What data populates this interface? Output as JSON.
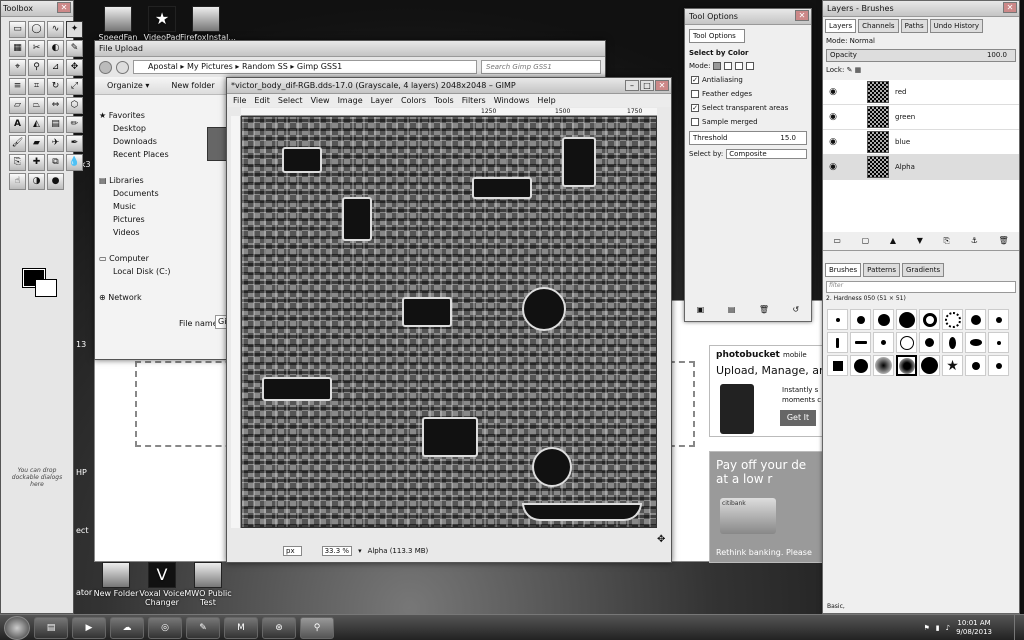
{
  "toolbox": {
    "title": "Toolbox",
    "hint": "You can drop dockable dialogs here"
  },
  "desktop": {
    "icons": [
      {
        "label": "SpeedFan"
      },
      {
        "label": "VideoPad"
      },
      {
        "label": "FirefoxInstal..."
      },
      {
        "label": "New Folder"
      },
      {
        "label": "Voxal Voice Changer"
      },
      {
        "label": "MWO Public Test"
      }
    ],
    "edge_fragments": [
      "HP",
      "ect",
      "ator",
      "ak3",
      "13"
    ]
  },
  "file_upload": {
    "title": "File Upload",
    "breadcrumb": [
      "Apostal",
      "My Pictures",
      "Random SS",
      "Gimp GSS1"
    ],
    "search_placeholder": "Search Gimp GSS1",
    "organize": "Organize ▾",
    "new_folder": "New folder",
    "nav": [
      "Favorites",
      "Desktop",
      "Downloads",
      "Recent Places",
      "",
      "Libraries",
      "Documents",
      "Music",
      "Pictures",
      "Videos",
      "",
      "Computer",
      "Local Disk (C:)",
      "",
      "Network"
    ],
    "file_name_label": "File name:",
    "file_name_value": "Gim"
  },
  "gimp": {
    "title": "*victor_body_dif-RGB.dds-17.0 (Grayscale, 4 layers) 2048x2048 – GIMP",
    "menu": [
      "File",
      "Edit",
      "Select",
      "View",
      "Image",
      "Layer",
      "Colors",
      "Tools",
      "Filters",
      "Windows",
      "Help"
    ],
    "ruler_ticks": [
      "1250",
      "1500",
      "1750"
    ],
    "status": {
      "unit": "px",
      "zoom": "33.3 %",
      "info": "Alpha (113.3 MB)"
    }
  },
  "tool_options": {
    "title": "Tool Options",
    "tab": "Tool Options",
    "section": "Select by Color",
    "mode_label": "Mode:",
    "options": [
      {
        "label": "Antialiasing",
        "checked": true
      },
      {
        "label": "Feather edges",
        "checked": false
      },
      {
        "label": "Select transparent areas",
        "checked": true
      },
      {
        "label": "Sample merged",
        "checked": false
      }
    ],
    "threshold_label": "Threshold",
    "threshold_value": "15.0",
    "select_by_label": "Select by:",
    "select_by_value": "Composite"
  },
  "layers": {
    "title": "Layers - Brushes",
    "tabs": [
      "Layers",
      "Channels",
      "Paths",
      "Undo History"
    ],
    "mode": "Mode: Normal",
    "opacity_label": "Opacity",
    "opacity_value": "100.0",
    "lock_label": "Lock:",
    "items": [
      {
        "name": "red"
      },
      {
        "name": "green"
      },
      {
        "name": "blue"
      },
      {
        "name": "Alpha"
      }
    ],
    "brush_tabs": [
      "Brushes",
      "Patterns",
      "Gradients"
    ],
    "filter_placeholder": "filter",
    "brush_name": "2. Hardness 050 (51 × 51)",
    "brush_footer": "Basic,"
  },
  "browser": {
    "photobucket": "photobucket",
    "photobucket_sub": "mobile",
    "upload_text": "Upload, Manage, ar",
    "instant": "Instantly s",
    "moments": "moments c",
    "get_it": "Get It",
    "payoff1": "Pay off your de",
    "payoff2": "at a low r",
    "citibank": "citibank",
    "rethink": "Rethink banking. Please"
  },
  "clock": {
    "time": "10:01 AM",
    "date": "9/08/2013"
  }
}
